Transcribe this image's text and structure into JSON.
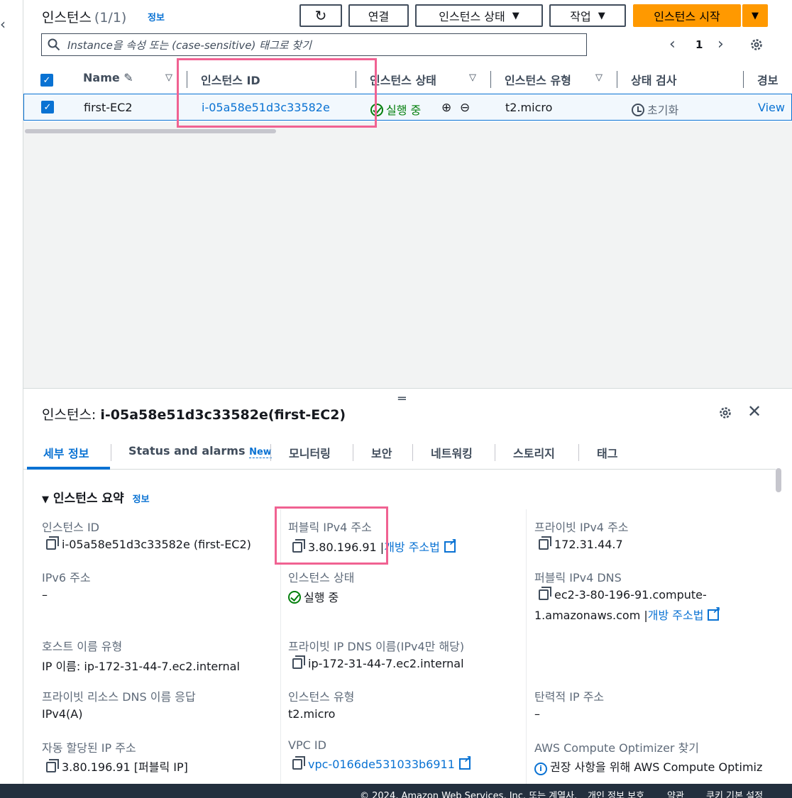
{
  "header": {
    "title": "인스턴스",
    "count": "(1/1)",
    "info": "정보",
    "buttons": {
      "connect": "연결",
      "instance_state": "인스턴스 상태",
      "actions": "작업",
      "launch": "인스턴스 시작"
    }
  },
  "search": {
    "placeholder": "Instance을 속성 또는 (case-sensitive) 태그로 찾기"
  },
  "pagination": {
    "page": "1"
  },
  "table": {
    "columns": [
      "Name",
      "인스턴스 ID",
      "인스턴스 상태",
      "인스턴스 유형",
      "상태 검사",
      "경보"
    ],
    "row": {
      "name": "first-EC2",
      "instance_id": "i-05a58e51d3c33582e",
      "state": "실행 중",
      "type": "t2.micro",
      "status_check": "초기화",
      "alarm": "View"
    }
  },
  "panel": {
    "title_prefix": "인스턴스:",
    "title_id": "i-05a58e51d3c33582e(first-EC2)",
    "tabs": [
      "세부 정보",
      "Status and alarms",
      "모니터링",
      "보안",
      "네트워킹",
      "스토리지",
      "태그"
    ],
    "tab_new_badge": "New",
    "section": "인스턴스 요약",
    "section_info": "정보",
    "fields": {
      "instance_id_label": "인스턴스 ID",
      "instance_id_value": "i-05a58e51d3c33582e (first-EC2)",
      "public_ipv4_label": "퍼블릭 IPv4 주소",
      "public_ipv4_value": "3.80.196.91",
      "open_address": "개방 주소법",
      "private_ipv4_label": "프라이빗 IPv4 주소",
      "private_ipv4_value": "172.31.44.7",
      "ipv6_label": "IPv6 주소",
      "ipv6_value": "–",
      "state_label": "인스턴스 상태",
      "state_value": "실행 중",
      "public_dns_label": "퍼블릭 IPv4 DNS",
      "public_dns_value_1": "ec2-3-80-196-91.compute-",
      "public_dns_value_2": "1.amazonaws.com",
      "hostname_type_label": "호스트 이름 유형",
      "hostname_type_value": "IP 이름: ip-172-31-44-7.ec2.internal",
      "private_dns_label": "프라이빗 IP DNS 이름(IPv4만 해당)",
      "private_dns_value": "ip-172-31-44-7.ec2.internal",
      "resource_dns_label": "프라이빗 리소스 DNS 이름 응답",
      "resource_dns_value": "IPv4(A)",
      "instance_type_label": "인스턴스 유형",
      "instance_type_value": "t2.micro",
      "elastic_ip_label": "탄력적 IP 주소",
      "elastic_ip_value": "–",
      "auto_ip_label": "자동 할당된 IP 주소",
      "auto_ip_value": "3.80.196.91 [퍼블릭 IP]",
      "vpc_label": "VPC ID",
      "vpc_value": "vpc-0166de531033b6911",
      "optimizer_label": "AWS Compute Optimizer 찾기",
      "optimizer_value": "권장 사항을 위해 AWS Compute Optimiz"
    }
  },
  "footer": {
    "copyright": "© 2024, Amazon Web Services, Inc. 또는 계열사.",
    "privacy": "개인 정보 보호",
    "terms": "약관",
    "cookies": "쿠키 기본 설정"
  },
  "colors": {
    "accent": "#0972d3",
    "primary_button": "#ff9900",
    "success": "#037f0c",
    "highlight": "#f06292",
    "footer_bg": "#232f3e"
  }
}
